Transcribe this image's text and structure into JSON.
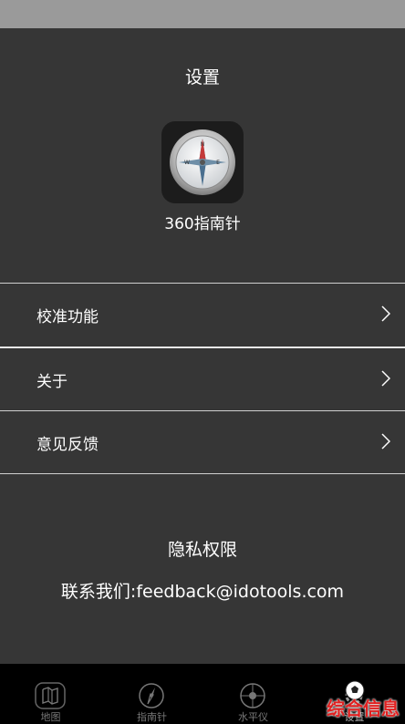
{
  "page": {
    "title": "设置"
  },
  "app": {
    "name": "360指南针",
    "icon": "compass-icon"
  },
  "menu": [
    {
      "label": "校准功能",
      "icon": "chevron-right-icon"
    },
    {
      "label": "关于",
      "icon": "chevron-right-icon"
    },
    {
      "label": "意见反馈",
      "icon": "chevron-right-icon"
    }
  ],
  "info": {
    "privacy": "隐私权限",
    "contact": "联系我们:feedback@idotools.com"
  },
  "tabs": [
    {
      "label": "地图",
      "icon": "map-icon"
    },
    {
      "label": "指南针",
      "icon": "compass-icon"
    },
    {
      "label": "水平仪",
      "icon": "level-icon"
    },
    {
      "label": "设置",
      "icon": "settings-icon",
      "active": true
    }
  ],
  "watermark": {
    "text": "综合信息",
    "color": "#e02020"
  },
  "colors": {
    "background": "#363636",
    "status_bar": "#9a9a9a",
    "tab_bar": "#000000"
  }
}
